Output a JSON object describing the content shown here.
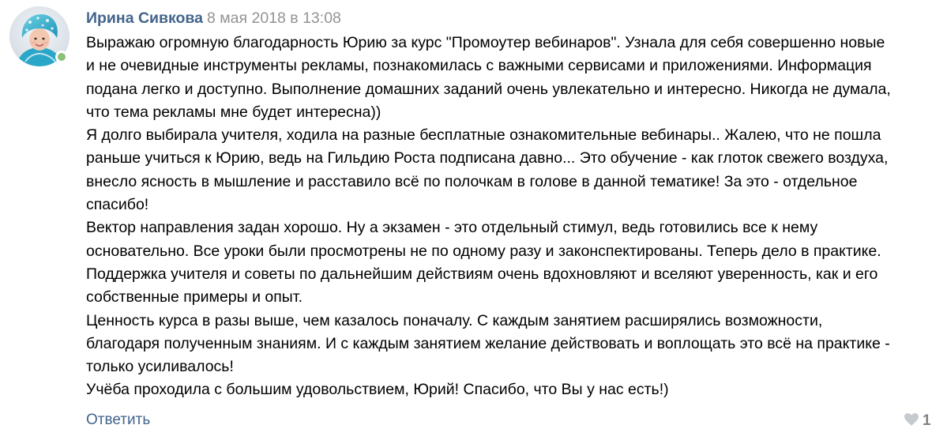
{
  "comment": {
    "author": "Ирина Сивкова",
    "date": "8 мая 2018 в 13:08",
    "lines": [
      "Выражаю огромную благодарность Юрию за курс \"Промоутер вебинаров\". Узнала для себя совершенно новые",
      "и не очевидные инструменты рекламы, познакомилась с важными сервисами и приложениями. Информация",
      "подана легко и доступно. Выполнение домашних заданий очень увлекательно и интересно. Никогда не думала,",
      "что тема рекламы мне будет интересна))",
      "Я долго выбирала учителя, ходила на разные бесплатные ознакомительные вебинары.. Жалею, что не пошла",
      "раньше учиться к Юрию, ведь на Гильдию Роста подписана давно... Это обучение - как глоток свежего воздуха,",
      "внесло ясность в мышление и расставило всё по полочкам в голове в данной тематике! За это - отдельное",
      "спасибо!",
      "Вектор направления задан хорошо. Ну а экзамен - это отдельный стимул, ведь готовились все к нему",
      "основательно. Все уроки были просмотрены не по одному разу и законспектированы. Теперь дело в практике.",
      "Поддержка учителя и советы по дальнейшим действиям очень вдохновляют и вселяют уверенность, как и его",
      "собственные примеры и опыт.",
      "Ценность курса в разы выше, чем казалось поначалу. С каждым занятием расширялись возможности,",
      "благодаря полученным знаниям. И с каждым занятием желание действовать и воплощать это всё на практике -",
      "только усиливалось!",
      "Учёба проходила с большим удовольствием, Юрий! Спасибо, что Вы у нас есть!)"
    ],
    "reply_label": "Ответить",
    "like_count": "1",
    "like_icon": "heart-icon",
    "online_status_icon": "online-dot",
    "colors": {
      "author": "#42648b",
      "date": "#939393",
      "link": "#42648b",
      "like": "#828282",
      "online": "#8ac176"
    }
  }
}
